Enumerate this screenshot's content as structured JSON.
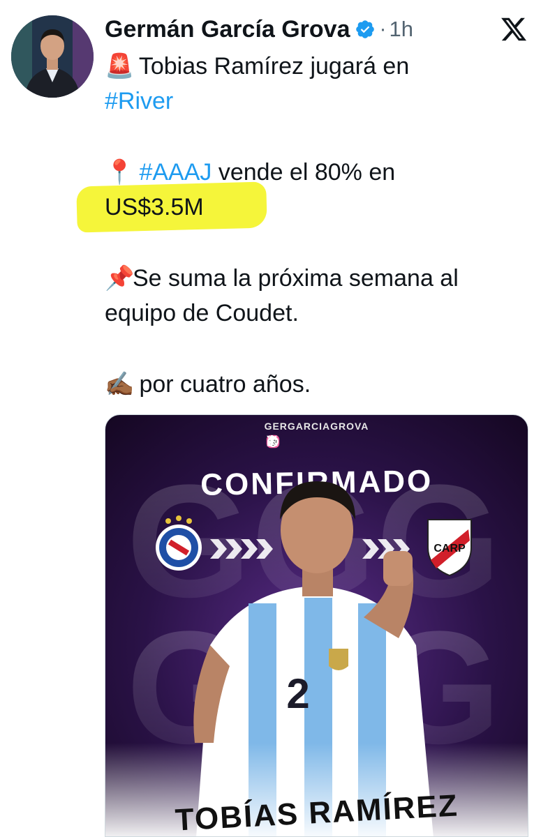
{
  "author": {
    "name": "Germán García Grova",
    "separator": "·",
    "time": "1h"
  },
  "tweet": {
    "line1_emoji": "🚨",
    "line1_text": " Tobias Ramírez jugará en",
    "line1_hashtag": "#River",
    "line2_emoji": "📍",
    "line2_hashtag": "#AAAJ",
    "line2_text": " vende el 80% en",
    "line2_amount": "US$3.5M",
    "line3_emoji": "📌",
    "line3_text": "Se suma la próxima semana al equipo de Coudet.",
    "line4_emoji": "✍🏾",
    "line4_text": "por cuatro años."
  },
  "media": {
    "handle": "GERGARCIAGROVA",
    "headline": "CONFIRMADO",
    "player_name": "TOBÍAS RAMÍREZ",
    "shirt_number": "2",
    "watermark": "GGG",
    "river_badge": "CARP",
    "social_icons": [
      "instagram-icon",
      "threads-icon",
      "x-icon",
      "tiktok-icon"
    ]
  },
  "colors": {
    "hashtag": "#1d9bf0",
    "highlight": "#f5f53a",
    "verified": "#1d9bf0",
    "muted": "#536471",
    "purple": "#4a2273"
  }
}
